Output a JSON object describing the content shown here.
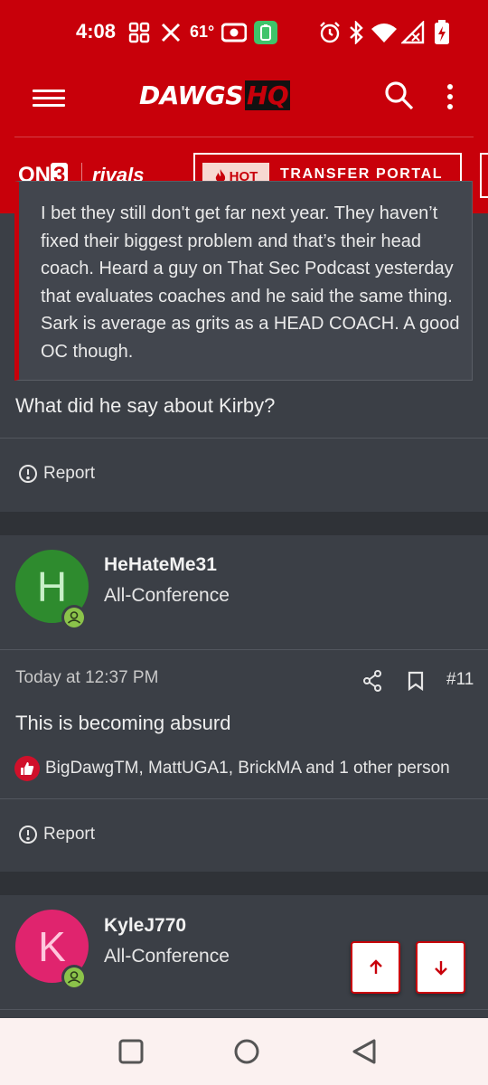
{
  "status_bar": {
    "time": "4:08",
    "temperature": "61°",
    "icons": [
      "grid-apps-icon",
      "x-app-icon",
      "camera-hotspot-icon",
      "battery-saver-icon",
      "alarm-icon",
      "bluetooth-icon",
      "wifi-icon",
      "signal-icon",
      "battery-charging-icon"
    ]
  },
  "header": {
    "logo_main": "DAWGS",
    "logo_suffix": "HQ",
    "brand_color": "#c8000a"
  },
  "subnav": {
    "on3_prefix": "ON",
    "on3_suffix": "3",
    "rivals": "rivals",
    "hot_badge": "HOT",
    "portal_label": "TRANSFER PORTAL"
  },
  "thread": {
    "quote_text": "I bet they still don't get far next year. They haven’t fixed their biggest problem and that’s their head coach. Heard a guy on That Sec Podcast yesterday that evaluates coaches and he said the same thing. Sark is average as grits as a HEAD COACH. A good OC though.",
    "reply_text": "What did he say about Kirby?",
    "report_label": "Report",
    "posts": [
      {
        "avatar_letter": "H",
        "avatar_color": "#2e8b2e",
        "username": "HeHateMe31",
        "user_title": "All-Conference",
        "timestamp": "Today at 12:37 PM",
        "post_number": "#11",
        "body": "This is becoming absurd",
        "reactions": "BigDawgTM, MattUGA1, BrickMA and 1 other person",
        "report_label": "Report"
      },
      {
        "avatar_letter": "K",
        "avatar_color": "#e0246e",
        "username": "KyleJ770",
        "user_title": "All-Conference"
      }
    ]
  }
}
